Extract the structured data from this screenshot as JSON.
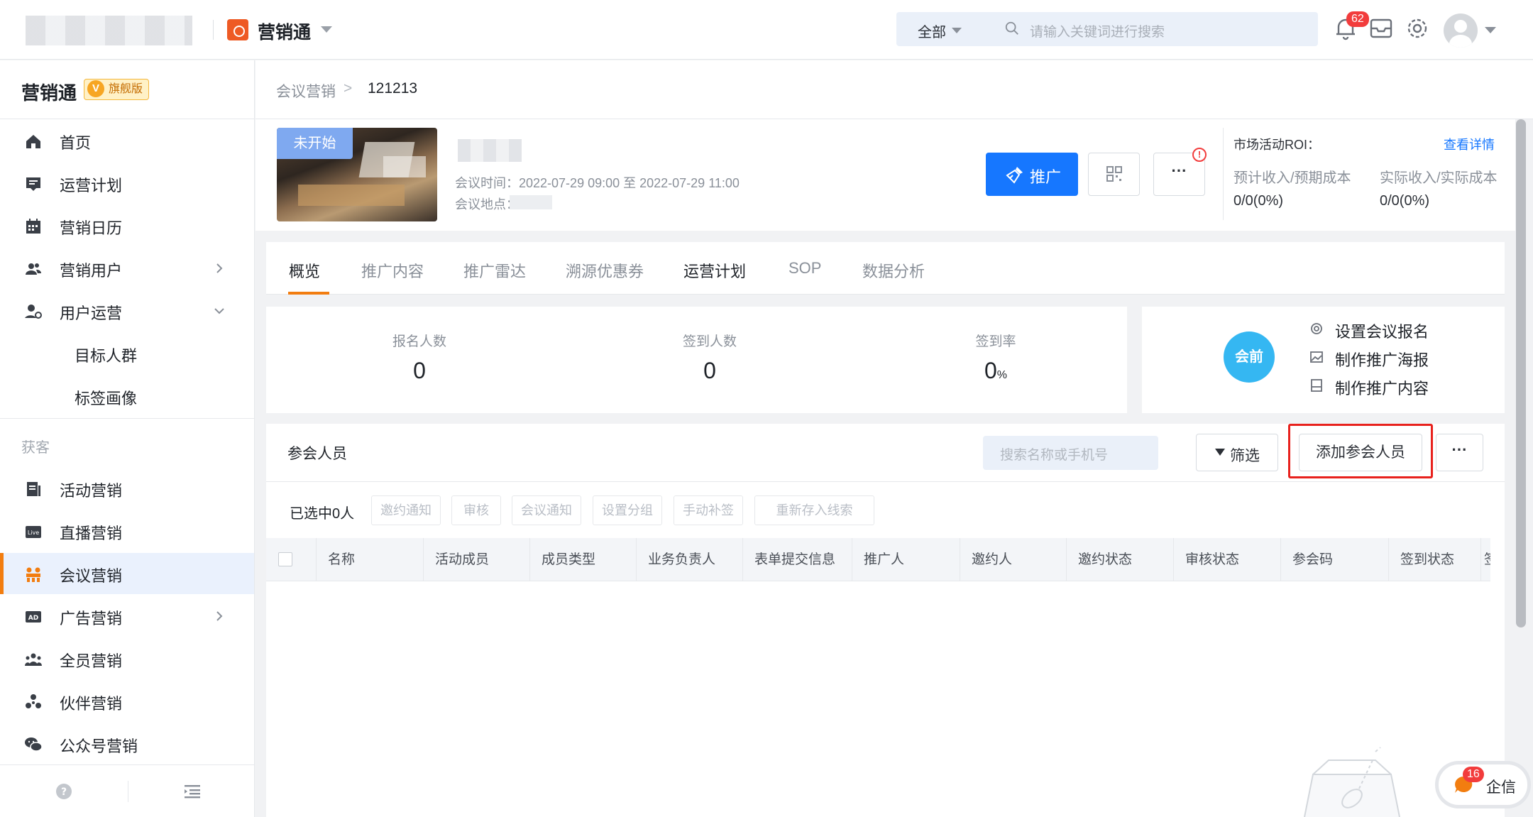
{
  "topbar": {
    "app_name": "营销通",
    "search_scope": "全部",
    "search_placeholder": "请输入关键词进行搜索",
    "notification_count": "62"
  },
  "sidebar": {
    "brand": "营销通",
    "edition": "旗舰版",
    "items": [
      {
        "label": "首页",
        "icon": "home-icon"
      },
      {
        "label": "运营计划",
        "icon": "plan-icon"
      },
      {
        "label": "营销日历",
        "icon": "calendar-icon"
      },
      {
        "label": "营销用户",
        "icon": "users-icon"
      },
      {
        "label": "用户运营",
        "icon": "user-ops-icon"
      },
      {
        "label": "目标人群"
      },
      {
        "label": "标签画像"
      }
    ],
    "group_label": "获客",
    "group_items": [
      {
        "label": "活动营销",
        "icon": "activity-icon"
      },
      {
        "label": "直播营销",
        "icon": "live-icon",
        "icon_text": "Live"
      },
      {
        "label": "会议营销",
        "icon": "meeting-icon"
      },
      {
        "label": "广告营销",
        "icon": "ad-icon",
        "icon_text": "AD"
      },
      {
        "label": "全员营销",
        "icon": "team-icon"
      },
      {
        "label": "伙伴营销",
        "icon": "partner-icon"
      },
      {
        "label": "公众号营销",
        "icon": "wechat-icon"
      }
    ]
  },
  "breadcrumb": {
    "parent": "会议营销",
    "separator": ">",
    "current": "121213"
  },
  "meeting": {
    "status": "未开始",
    "time_label": "会议时间：",
    "time_value": "2022-07-29 09:00 至 2022-07-29 11:00",
    "place_label": "会议地点：",
    "promote_label": "推广",
    "more_label": "···"
  },
  "roi": {
    "title": "市场活动ROI：",
    "link": "查看详情",
    "expected_label": "预计收入/预期成本",
    "expected_value": "0/0(0%)",
    "actual_label": "实际收入/实际成本",
    "actual_value": "0/0(0%)"
  },
  "tabs": [
    "概览",
    "推广内容",
    "推广雷达",
    "溯源优惠券",
    "运营计划",
    "SOP",
    "数据分析"
  ],
  "stats": [
    {
      "label": "报名人数",
      "value": "0",
      "unit": ""
    },
    {
      "label": "签到人数",
      "value": "0",
      "unit": ""
    },
    {
      "label": "签到率",
      "value": "0",
      "unit": "%"
    }
  ],
  "phase": {
    "name": "会前",
    "actions": [
      "设置会议报名",
      "制作推广海报",
      "制作推广内容"
    ]
  },
  "participants": {
    "title": "参会人员",
    "search_placeholder": "搜索名称或手机号",
    "filter_label": "筛选",
    "add_label": "添加参会人员",
    "more_label": "···",
    "selected": "已选中0人",
    "actions": [
      "邀约通知",
      "审核",
      "会议通知",
      "设置分组",
      "手动补签",
      "重新存入线索"
    ],
    "columns": [
      "名称",
      "活动成员",
      "成员类型",
      "业务负责人",
      "表单提交信息",
      "推广人",
      "邀约人",
      "邀约状态",
      "审核状态",
      "参会码",
      "签到状态",
      "签"
    ]
  },
  "qixin": {
    "label": "企信",
    "count": "16"
  },
  "colors": {
    "primary": "#1677ff",
    "accent": "#f27d10",
    "highlight": "#e8211d",
    "phase": "#35b7f2"
  }
}
